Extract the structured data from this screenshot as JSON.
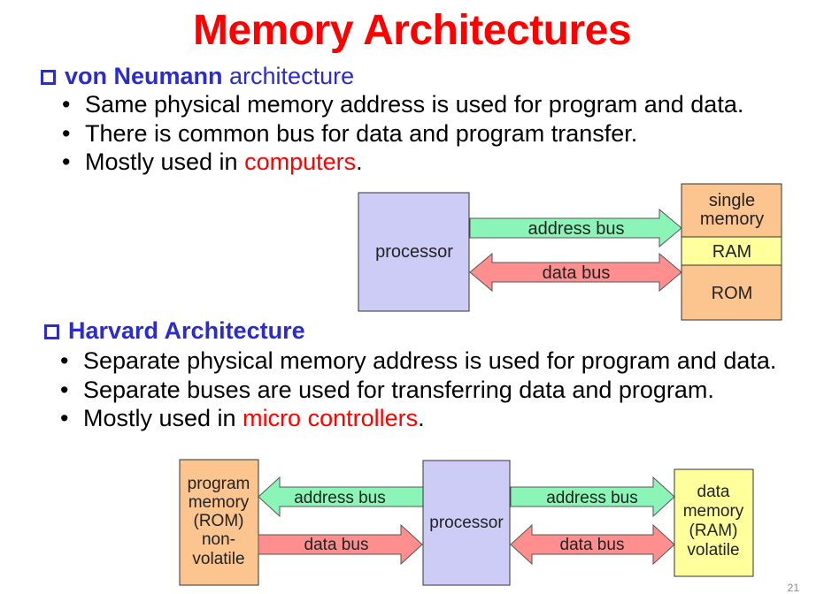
{
  "title": "Memory Architectures",
  "von_neumann": {
    "heading_bold": "von Neumann",
    "heading_rest": " architecture",
    "bullets": [
      "Same physical memory address is used for program and data.",
      "There is common bus for data and program transfer."
    ],
    "bullet3_prefix": "Mostly used in ",
    "bullet3_highlight": "computers",
    "bullet3_suffix": ".",
    "diagram": {
      "processor": "processor",
      "address_bus": "address bus",
      "data_bus": "data bus",
      "memory_title_line1": "single",
      "memory_title_line2": "memory",
      "ram": "RAM",
      "rom": "ROM"
    }
  },
  "harvard": {
    "heading": "Harvard Architecture",
    "bullets": [
      "Separate physical memory address is used for program and data.",
      "Separate buses are used for transferring data and program."
    ],
    "bullet3_prefix": "Mostly used in ",
    "bullet3_highlight": "micro controllers",
    "bullet3_suffix": ".",
    "diagram": {
      "program_memory_lines": [
        "program",
        "memory",
        "(ROM)",
        "non-",
        "volatile"
      ],
      "processor": "processor",
      "left_address_bus": "address bus",
      "left_data_bus": "data bus",
      "right_address_bus": "address bus",
      "right_data_bus": "data bus",
      "data_memory_lines": [
        "data",
        "memory",
        "(RAM)",
        "volatile"
      ]
    }
  },
  "page_number": "21",
  "colors": {
    "title": "#ff0000",
    "heading": "#2b2bd1",
    "processor_fill": "#ccccf7",
    "memory_fill": "#fcc48e",
    "ram_fill": "#ffff9c",
    "address_bus_fill": "#8bf5b7",
    "data_bus_fill": "#ff8f8f"
  }
}
